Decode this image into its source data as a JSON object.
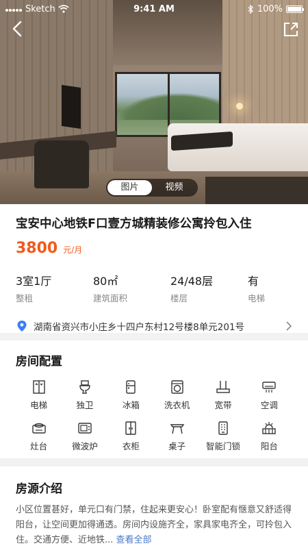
{
  "status_bar": {
    "carrier": "Sketch",
    "time": "9:41 AM",
    "battery": "100%"
  },
  "media_tabs": [
    "图片",
    "视频"
  ],
  "listing": {
    "title": "宝安中心地铁F口壹方城精装修公寓拎包入住",
    "price": "3800",
    "price_unit": "元/月",
    "specs": [
      {
        "value": "3室1厅",
        "label": "整租"
      },
      {
        "value": "80㎡",
        "label": "建筑面积"
      },
      {
        "value": "24/48层",
        "label": "楼层"
      },
      {
        "value": "有",
        "label": "电梯"
      }
    ],
    "address": "湖南省资兴市小庄乡十四户东村12号楼8单元201号"
  },
  "facilities": {
    "title": "房间配置",
    "items": [
      {
        "label": "电梯",
        "icon": "elevator-icon"
      },
      {
        "label": "独卫",
        "icon": "toilet-icon"
      },
      {
        "label": "冰箱",
        "icon": "fridge-icon"
      },
      {
        "label": "洗衣机",
        "icon": "washer-icon"
      },
      {
        "label": "宽带",
        "icon": "router-icon"
      },
      {
        "label": "空调",
        "icon": "air-conditioner-icon"
      },
      {
        "label": "灶台",
        "icon": "stove-icon"
      },
      {
        "label": "微波炉",
        "icon": "microwave-icon"
      },
      {
        "label": "衣柜",
        "icon": "wardrobe-icon"
      },
      {
        "label": "桌子",
        "icon": "table-icon"
      },
      {
        "label": "智能门锁",
        "icon": "smart-lock-icon"
      },
      {
        "label": "阳台",
        "icon": "balcony-icon"
      }
    ]
  },
  "description": {
    "title": "房源介绍",
    "text": "小区位置甚好，单元口有门禁，住起来更安心！卧室配有惬意又舒适得阳台，让空间更加得通透。房间内设施齐全，家具家电齐全，可拎包入住。交通方便、近地铁...",
    "see_all": "查看全部"
  },
  "colors": {
    "accent": "#f25a1b",
    "link": "#4a78c8",
    "pin": "#3b7ff5"
  }
}
